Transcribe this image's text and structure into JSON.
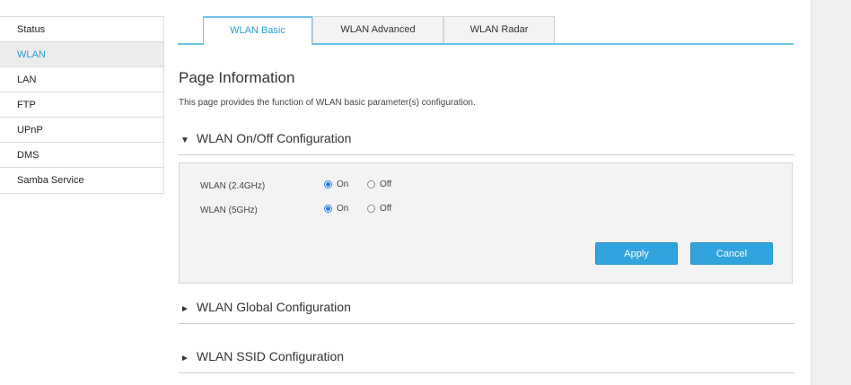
{
  "sidebar": {
    "items": [
      {
        "label": "Status"
      },
      {
        "label": "WLAN"
      },
      {
        "label": "LAN"
      },
      {
        "label": "FTP"
      },
      {
        "label": "UPnP"
      },
      {
        "label": "DMS"
      },
      {
        "label": "Samba Service"
      }
    ],
    "active": "WLAN"
  },
  "tabs": [
    {
      "label": "WLAN Basic"
    },
    {
      "label": "WLAN Advanced"
    },
    {
      "label": "WLAN Radar"
    }
  ],
  "page": {
    "title": "Page Information",
    "description": "This page provides the function of WLAN basic parameter(s) configuration."
  },
  "sections": {
    "onoff": {
      "label": "WLAN On/Off Configuration",
      "arrow": "▼"
    },
    "global": {
      "label": "WLAN Global Configuration",
      "arrow": "►"
    },
    "ssid": {
      "label": "WLAN SSID Configuration",
      "arrow": "►"
    }
  },
  "wlan_onoff": {
    "rows": [
      {
        "label": "WLAN (2.4GHz)",
        "on": "On",
        "off": "Off",
        "selected": "On"
      },
      {
        "label": "WLAN (5GHz)",
        "on": "On",
        "off": "Off",
        "selected": "On"
      }
    ],
    "apply_label": "Apply",
    "cancel_label": "Cancel"
  },
  "colors": {
    "accent": "#2a9fd6",
    "button": "#32a4dd",
    "tab_border": "#6cc3e8"
  }
}
